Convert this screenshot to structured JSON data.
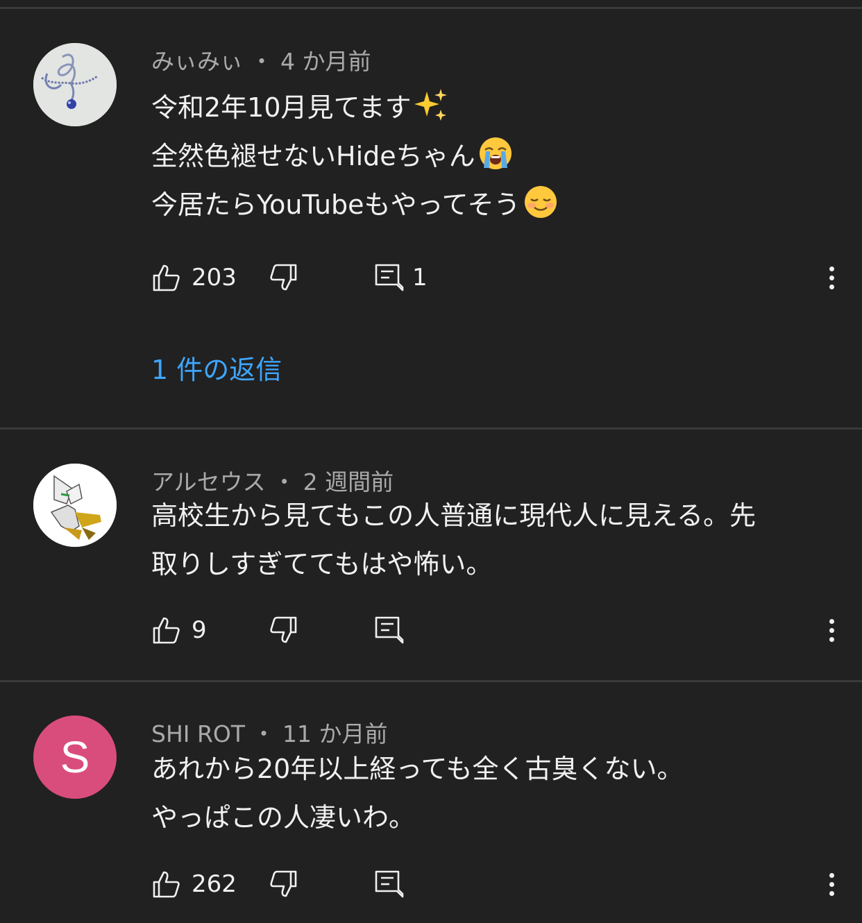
{
  "comments": [
    {
      "author": "みぃみぃ",
      "time": "4 か月前",
      "lines": [
        "令和2年10月見てます",
        "全然色褪せないHideちゃん",
        "今居たらYouTubeもやってそう"
      ],
      "line_emoji": [
        "sparkles-emoji",
        "loudly-crying-face-emoji",
        "smiling-face-emoji"
      ],
      "likes": "203",
      "reply_count": "1",
      "replies_link": "1 件の返信"
    },
    {
      "author": "アルセウス",
      "time": "2 週間前",
      "lines": [
        "高校生から見てもこの人普通に現代人に見える。先",
        "取りしすぎててもはや怖い。"
      ],
      "likes": "9",
      "reply_count": ""
    },
    {
      "author": "SHI ROT",
      "time": "11 か月前",
      "avatar_letter": "S",
      "avatar_color": "#d94d7c",
      "lines": [
        "あれから20年以上経っても全く古臭くない。",
        "やっぱこの人凄いわ。"
      ],
      "likes": "262",
      "reply_count": ""
    }
  ],
  "separator": "・",
  "colors": {
    "background": "#212121",
    "meta": "#aaaaaa",
    "link": "#3ea6ff"
  },
  "icons": [
    "thumbs-up-icon",
    "thumbs-down-icon",
    "reply-icon",
    "more-vert-icon"
  ]
}
